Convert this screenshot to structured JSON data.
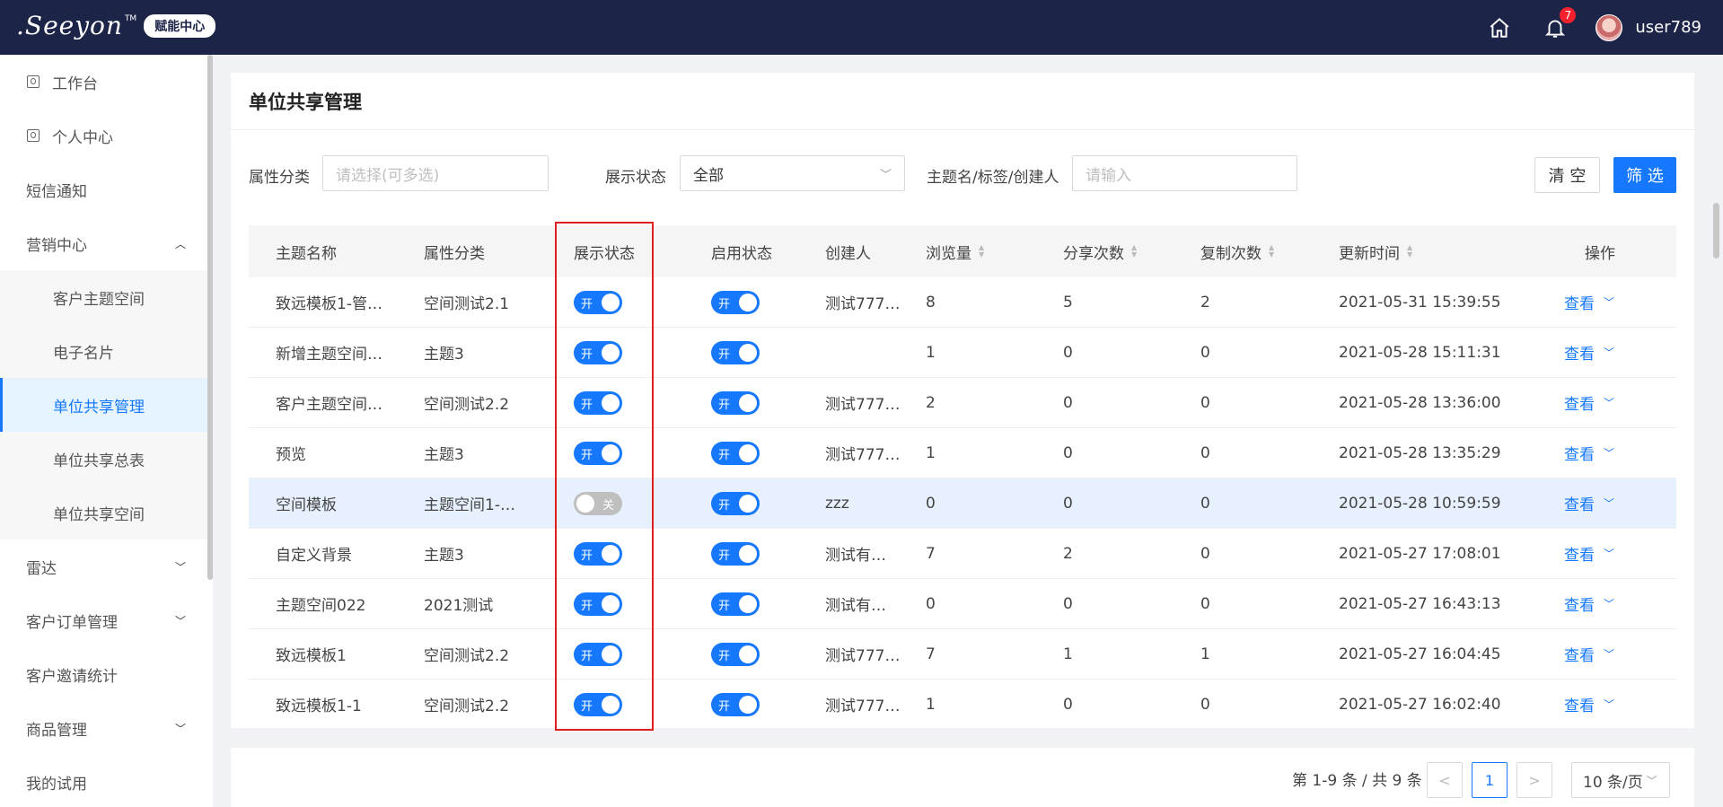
{
  "header": {
    "logo_text": ".Seeyon",
    "logo_tm": "TM",
    "logo_badge": "赋能中心",
    "notification_count": "7",
    "username": "user789"
  },
  "sidebar": {
    "items": [
      {
        "label": "工作台"
      },
      {
        "label": "个人中心"
      },
      {
        "label": "短信通知"
      },
      {
        "label": "营销中心"
      },
      {
        "label": "客户主题空间"
      },
      {
        "label": "电子名片"
      },
      {
        "label": "单位共享管理"
      },
      {
        "label": "单位共享总表"
      },
      {
        "label": "单位共享空间"
      },
      {
        "label": "雷达"
      },
      {
        "label": "客户订单管理"
      },
      {
        "label": "客户邀请统计"
      },
      {
        "label": "商品管理"
      },
      {
        "label": "我的试用"
      }
    ]
  },
  "page": {
    "title": "单位共享管理"
  },
  "filters": {
    "category_label": "属性分类",
    "category_placeholder": "请选择(可多选)",
    "status_label": "展示状态",
    "status_value": "全部",
    "keyword_label": "主题名/标签/创建人",
    "keyword_placeholder": "请输入",
    "clear_label": "清 空",
    "filter_label": "筛 选"
  },
  "table": {
    "columns": {
      "name": "主题名称",
      "category": "属性分类",
      "display": "展示状态",
      "enabled": "启用状态",
      "creator": "创建人",
      "views": "浏览量",
      "shares": "分享次数",
      "copies": "复制次数",
      "updated": "更新时间",
      "actions": "操作"
    },
    "toggle_on": "开",
    "toggle_off": "关",
    "view_label": "查看",
    "rows": [
      {
        "name": "致远模板1-管…",
        "category": "空间测试2.1",
        "display": "开",
        "enabled": "开",
        "creator": "测试777…",
        "views": "8",
        "shares": "5",
        "copies": "2",
        "updated": "2021-05-31 15:39:55"
      },
      {
        "name": "新增主题空间…",
        "category": "主题3",
        "display": "开",
        "enabled": "开",
        "creator": "",
        "views": "1",
        "shares": "0",
        "copies": "0",
        "updated": "2021-05-28 15:11:31"
      },
      {
        "name": "客户主题空间…",
        "category": "空间测试2.2",
        "display": "开",
        "enabled": "开",
        "creator": "测试777…",
        "views": "2",
        "shares": "0",
        "copies": "0",
        "updated": "2021-05-28 13:36:00"
      },
      {
        "name": "预览",
        "category": "主题3",
        "display": "开",
        "enabled": "开",
        "creator": "测试777…",
        "views": "1",
        "shares": "0",
        "copies": "0",
        "updated": "2021-05-28 13:35:29"
      },
      {
        "name": "空间模板",
        "category": "主题空间1-…",
        "display": "关",
        "enabled": "开",
        "creator": "zzz",
        "views": "0",
        "shares": "0",
        "copies": "0",
        "updated": "2021-05-28 10:59:59"
      },
      {
        "name": "自定义背景",
        "category": "主题3",
        "display": "开",
        "enabled": "开",
        "creator": "测试有…",
        "views": "7",
        "shares": "2",
        "copies": "0",
        "updated": "2021-05-27 17:08:01"
      },
      {
        "name": "主题空间022",
        "category": "2021测试",
        "display": "开",
        "enabled": "开",
        "creator": "测试有…",
        "views": "0",
        "shares": "0",
        "copies": "0",
        "updated": "2021-05-27 16:43:13"
      },
      {
        "name": "致远模板1",
        "category": "空间测试2.2",
        "display": "开",
        "enabled": "开",
        "creator": "测试777…",
        "views": "7",
        "shares": "1",
        "copies": "1",
        "updated": "2021-05-27 16:04:45"
      },
      {
        "name": "致远模板1-1",
        "category": "空间测试2.2",
        "display": "开",
        "enabled": "开",
        "creator": "测试777…",
        "views": "1",
        "shares": "0",
        "copies": "0",
        "updated": "2021-05-27 16:02:40"
      }
    ]
  },
  "pagination": {
    "total_text": "第 1-9 条 / 共 9 条",
    "current_page": "1",
    "prev": "<",
    "next": ">",
    "page_size": "10 条/页"
  },
  "colors": {
    "header_bg": "#1c2448",
    "primary": "#1677ff",
    "highlight_border": "#e02020"
  }
}
